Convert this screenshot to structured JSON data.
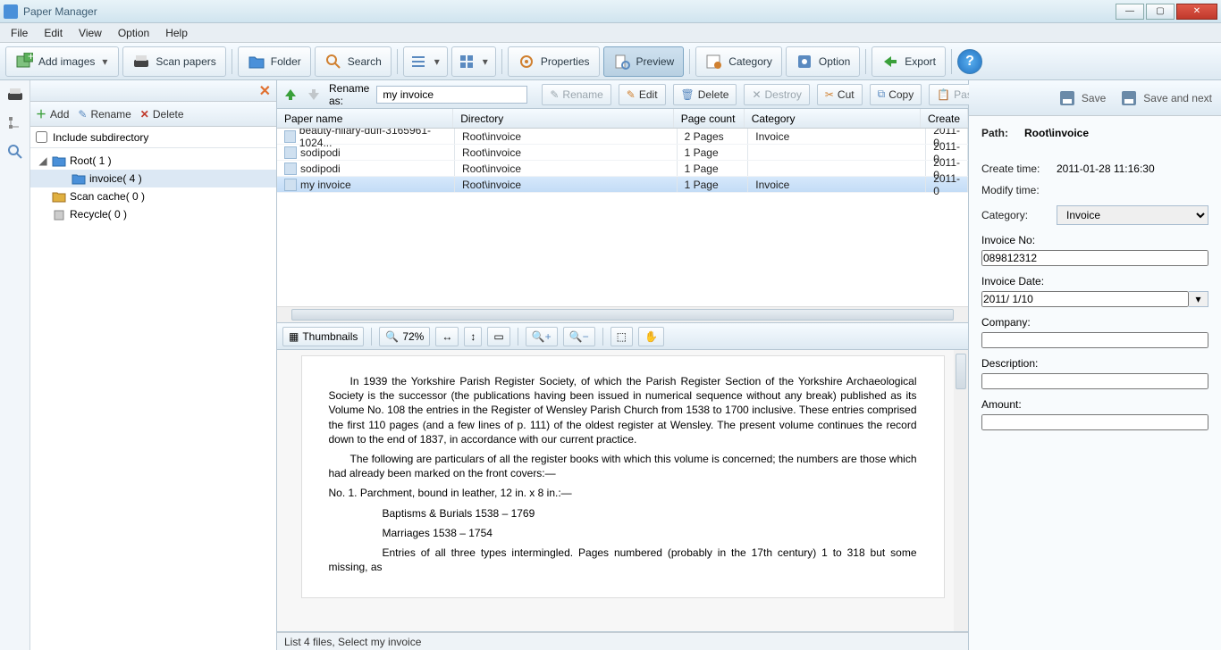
{
  "title": "Paper Manager",
  "menu": [
    "File",
    "Edit",
    "View",
    "Option",
    "Help"
  ],
  "toolbar": {
    "add_images": "Add images",
    "scan_papers": "Scan papers",
    "folder": "Folder",
    "search": "Search",
    "properties": "Properties",
    "preview": "Preview",
    "category": "Category",
    "option": "Option",
    "export": "Export"
  },
  "leftpanel": {
    "add": "Add",
    "rename": "Rename",
    "delete": "Delete",
    "include_sub": "Include subdirectory",
    "tree": {
      "root": "Root( 1 )",
      "invoice": "invoice( 4 )",
      "scan_cache": "Scan cache( 0 )",
      "recycle": "Recycle( 0 )"
    }
  },
  "center_top": {
    "rename_as_lbl": "Rename as:",
    "rename_as_val": "my invoice",
    "rename": "Rename",
    "edit": "Edit",
    "delete": "Delete",
    "destroy": "Destroy",
    "cut": "Cut",
    "copy": "Copy",
    "paste": "Paste"
  },
  "grid": {
    "headers": {
      "name": "Paper name",
      "dir": "Directory",
      "pages": "Page count",
      "cat": "Category",
      "create": "Create"
    },
    "rows": [
      {
        "name": "beauty-hilary-duff-3165961-1024...",
        "dir": "Root\\invoice",
        "pages": "2 Pages",
        "cat": "Invoice",
        "create": "2011-0"
      },
      {
        "name": "sodipodi",
        "dir": "Root\\invoice",
        "pages": "1 Page",
        "cat": "",
        "create": "2011-0"
      },
      {
        "name": "sodipodi",
        "dir": "Root\\invoice",
        "pages": "1 Page",
        "cat": "",
        "create": "2011-0"
      },
      {
        "name": "my invoice",
        "dir": "Root\\invoice",
        "pages": "1 Page",
        "cat": "Invoice",
        "create": "2011-0"
      }
    ]
  },
  "preview_tools": {
    "thumbnails": "Thumbnails",
    "zoom": "72%"
  },
  "preview_text": {
    "p1": "In 1939 the Yorkshire Parish Register Society, of which the Parish Register Section of the Yorkshire Archaeological Society is the successor (the publications having been issued in numerical sequence without any break) published as its Volume No. 108 the entries in the Register of Wensley Parish Church from 1538 to 1700 inclusive. These entries comprised the first 110 pages (and a few lines of p. 111) of the oldest register at Wensley. The present volume continues the record down to the end of 1837, in accordance with our current practice.",
    "p2": "The following are particulars of all the register books with which this volume is concerned; the numbers are those which had already been marked on the front covers:—",
    "p3": "No. 1.   Parchment, bound in leather, 12 in. x 8 in.:—",
    "p4": "Baptisms & Burials 1538 – 1769",
    "p5": "Marriages              1538 – 1754",
    "p6": "Entries of all three types intermingled. Pages numbered (probably in the 17th century) 1 to 318 but some missing, as"
  },
  "status": "List 4 files, Select my invoice",
  "right": {
    "save": "Save",
    "save_next": "Save and next",
    "path_lbl": "Path:",
    "path_val": "Root\\invoice",
    "create_lbl": "Create time:",
    "create_val": "2011-01-28 11:16:30",
    "modify_lbl": "Modify time:",
    "modify_val": "",
    "category_lbl": "Category:",
    "category_val": "Invoice",
    "invoice_no_lbl": "Invoice No:",
    "invoice_no_val": "089812312",
    "invoice_date_lbl": "Invoice Date:",
    "invoice_date_val": "2011/ 1/10",
    "company_lbl": "Company:",
    "company_val": "",
    "desc_lbl": "Description:",
    "desc_val": "",
    "amount_lbl": "Amount:",
    "amount_val": ""
  }
}
